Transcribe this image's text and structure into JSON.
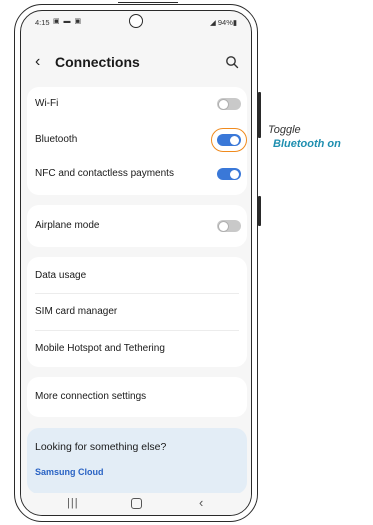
{
  "status_bar": {
    "time": "4:15",
    "left_icons": "▣ ▬ ▣",
    "right_text": "◢ 94%▮"
  },
  "header": {
    "title": "Connections"
  },
  "connections": {
    "wifi": {
      "label": "Wi-Fi",
      "enabled": false
    },
    "bluetooth": {
      "label": "Bluetooth",
      "enabled": true
    },
    "nfc": {
      "label": "NFC and contactless payments",
      "enabled": true
    }
  },
  "airplane": {
    "label": "Airplane mode",
    "enabled": false
  },
  "menu_items": [
    {
      "label": "Data usage"
    },
    {
      "label": "SIM card manager"
    },
    {
      "label": "Mobile Hotspot and Tethering"
    }
  ],
  "more": {
    "label": "More connection settings"
  },
  "looking": {
    "title": "Looking for something else?",
    "link": "Samsung Cloud"
  },
  "nav": {
    "recent": "|||",
    "back": "‹"
  },
  "callout": {
    "line1": "Toggle",
    "line2": "Bluetooth on"
  },
  "colors": {
    "toggle_on": "#3a78d8",
    "toggle_off": "#c9c9c9",
    "highlight": "#f08a1d",
    "callout_accent": "#1f8fb0",
    "link": "#2a63c4"
  }
}
